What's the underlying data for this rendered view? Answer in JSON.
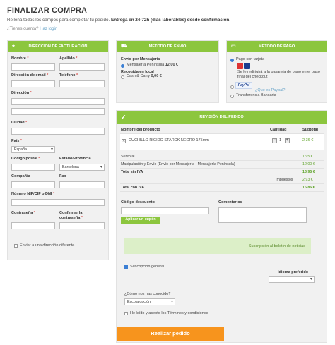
{
  "page": {
    "title": "FINALIZAR COMPRA",
    "subtitle_pre": "Rellena todos los campos para completar tu pedido. ",
    "subtitle_bold": "Entrega en 24-72h (días laborables) desde confirmación",
    "subtitle_post": ".",
    "login_question": "¿Tienes cuenta?",
    "login_link": "Haz login"
  },
  "billing": {
    "header": "DIRECCIÓN DE FACTURACIÓN",
    "nombre": "Nombre",
    "apellido": "Apellido",
    "email": "Dirección de email",
    "telefono": "Teléfono",
    "direccion": "Dirección",
    "ciudad": "Ciudad",
    "pais": "País",
    "pais_value": "España",
    "codigo_postal": "Código postal",
    "provincia": "Estado/Provincia",
    "provincia_value": "Barcelona",
    "compania": "Compañía",
    "fax": "Fax",
    "nif": "Número NIF/CIF o DNI",
    "contrasena": "Contraseña",
    "confirmar_1": "Confirmar la",
    "confirmar_2": "contraseña",
    "required_mark": "*",
    "otra_direccion": "Enviar a una dirección diferente"
  },
  "shipping": {
    "header": "MÉTODO DE ENVÍO",
    "group1": "Envío por Mensajería",
    "option1_label": "Mensajería Península",
    "option1_price": "12,00 €",
    "group2": "Recogida en local",
    "option2_label": "Cash & Carry",
    "option2_price": "0,00 €"
  },
  "payment": {
    "header": "MÉTODO DE PAGO",
    "option1": "Pago con tarjeta",
    "option1_note": "Se le redirigirá a la pasarela de pago en el paso final del checkout",
    "paypal_logo": "PayPal",
    "paypal_link": "¿Qué es Paypal?",
    "option3": "Transferencia Bancaria"
  },
  "review": {
    "header": "REVISIÓN DEL PEDIDO",
    "col_name": "Nombre del producto",
    "col_qty": "Cantidad",
    "col_subtotal": "Subtotal",
    "product": "CUCHILLO RÍGIDO STARCK NEGRO 175mm",
    "qty": "1",
    "product_price": "2,36 €",
    "rows": [
      {
        "label": "Subtotal",
        "value": "1,95 €",
        "bold": false
      },
      {
        "label": "Manipulación y Envío (Envío por Mensajería - Mensajería Península)",
        "value": "12,00 €",
        "bold": false
      },
      {
        "label": "Total sin IVA",
        "value": "13,95 €",
        "bold": true
      },
      {
        "label": "Impuestos",
        "value": "2,93 €",
        "bold": false
      },
      {
        "label": "Total con IVA",
        "value": "16,86 €",
        "bold": true
      }
    ],
    "discount_label": "Código descuento",
    "apply_button": "Aplicar un cupón",
    "comments_label": "Comentarios",
    "newsletter_banner": "Suscripción al boletín de noticias",
    "newsletter_check": "Suscripción general",
    "language_label": "Idioma preferido",
    "how_label": "¿Cómo nos has conocido?",
    "how_value": "Escoja opción",
    "terms": "He leído y acepto los Términos y condiciones",
    "submit": "Realizar pedido"
  },
  "colors": {
    "accent_green": "#8cc63e",
    "price_green": "#5fa32a",
    "submit_orange": "#f7941d"
  }
}
